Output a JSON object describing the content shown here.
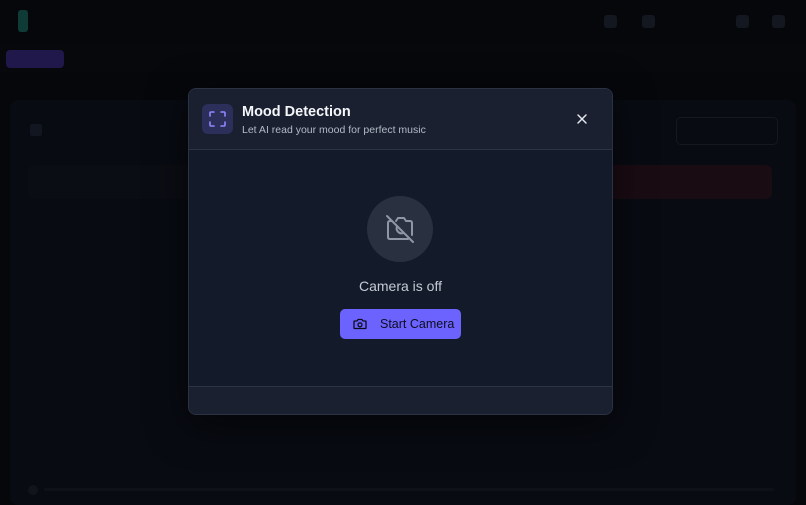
{
  "background_app": {
    "nav_tabs": [
      "",
      "",
      ""
    ],
    "colors": {
      "brand": "#0f3b37",
      "active_tab": "#20184a"
    }
  },
  "modal": {
    "title": "Mood Detection",
    "subtitle": "Let AI read your mood for perfect music",
    "header_icon": "scan-frame-icon",
    "close_icon": "close-icon",
    "camera_status": "Camera is off",
    "camera_off_icon": "camera-off-icon",
    "start_button": {
      "label": "Start Camera",
      "icon": "camera-icon"
    },
    "colors": {
      "accent": "#6c63ff",
      "surface": "#141a28",
      "header": "#1a2030",
      "title": "#f4f6fa",
      "subtitle": "#b3bac7"
    }
  }
}
